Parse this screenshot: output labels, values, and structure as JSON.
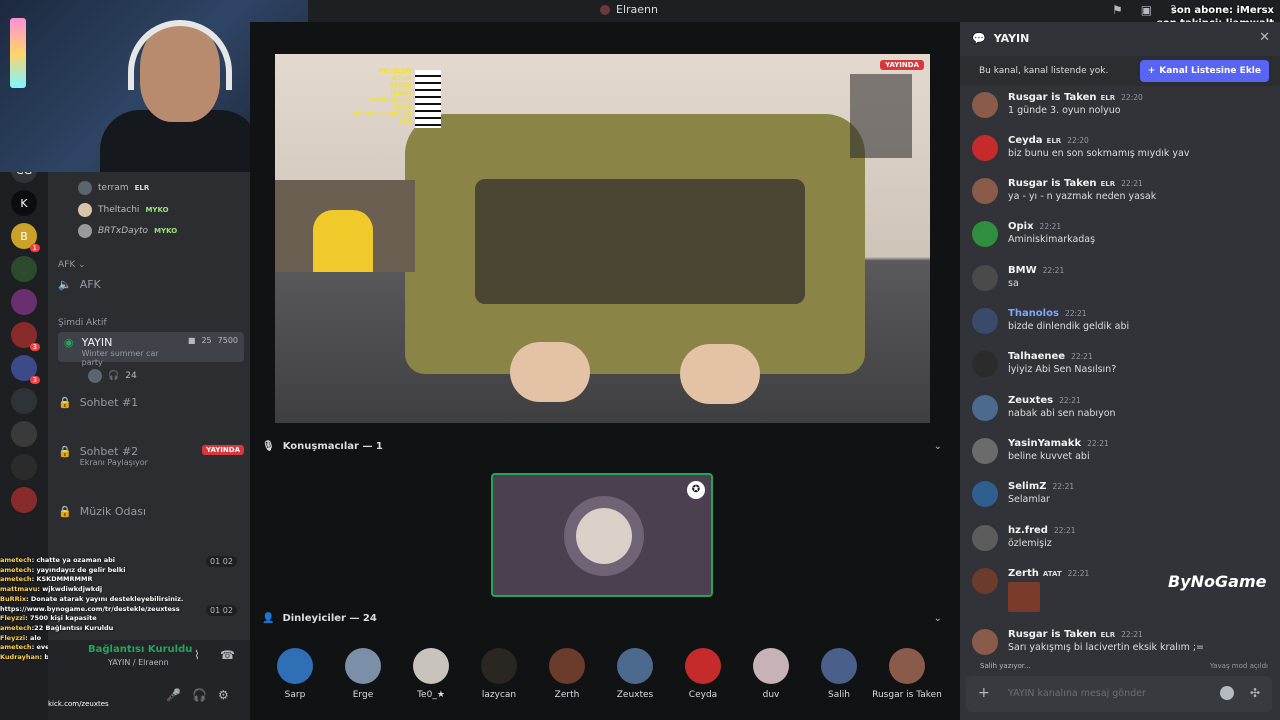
{
  "topbar": {
    "title": "Elraenn"
  },
  "overlay": {
    "line1": "son abone: iMersx",
    "line2": "son takipçi: liamwalt"
  },
  "rail": {
    "servers": [
      {
        "label": "CG",
        "color": "#313338",
        "badge": ""
      },
      {
        "label": "K",
        "color": "#0c0d10",
        "badge": ""
      },
      {
        "label": "B",
        "color": "#c9a227",
        "badge": "1"
      },
      {
        "label": "",
        "color": "#2c4a2c",
        "badge": ""
      },
      {
        "label": "",
        "color": "#6a2f6e",
        "badge": ""
      },
      {
        "label": "",
        "color": "#8a2b2b",
        "badge": "3"
      },
      {
        "label": "",
        "color": "#3c4a8a",
        "badge": "3"
      },
      {
        "label": "",
        "color": "#2e3338",
        "badge": ""
      },
      {
        "label": "",
        "color": "#3a3a3a",
        "badge": ""
      },
      {
        "label": "",
        "color": "#2b2b2b",
        "badge": ""
      },
      {
        "label": "",
        "color": "#8a2b2b",
        "badge": ""
      }
    ]
  },
  "sidebar": {
    "users": [
      {
        "name": "terram",
        "role": "ELR"
      },
      {
        "name": "Theltachi",
        "role": "MYKO"
      },
      {
        "name": "BRTxDayto",
        "role": "MYKO"
      }
    ],
    "afk_category": "AFK",
    "afk_channel": "AFK",
    "active_now": "Şimdi Aktif",
    "yayin": {
      "name": "YAYIN",
      "subtitle": "Winter summer car party",
      "count1": "25",
      "count2": "7500",
      "listeners": "24"
    },
    "sohbet1": "Sohbet #1",
    "sohbet2": {
      "name": "Sohbet #2",
      "subtitle": "Ekranı Paylaşıyor",
      "live": "YAYINDA"
    },
    "muzik": "Müzik Odası",
    "pill_a": "01 02",
    "pill_b": "01 02"
  },
  "twitch_chat": [
    {
      "n": "ametech",
      "t": ": chatte ya ozaman abi"
    },
    {
      "n": "ametech",
      "t": ": yayındayız de gelir belki"
    },
    {
      "n": "ametech",
      "t": ": KSKDMMRMMR"
    },
    {
      "n": "mattmavu",
      "t": ": wjkwdiwkdjwkdj"
    },
    {
      "n": "BuRRix",
      "t": ": Donate atarak yayını destekleyebilirsiniz."
    },
    {
      "n": "",
      "t": "https://www.bynogame.com/tr/destekle/zeuxtess"
    },
    {
      "n": "Fleyzzi",
      "t": ": 7500 kişi kapasite"
    },
    {
      "n": "ametech",
      "t": ":22 Bağlantısı Kuruldu"
    },
    {
      "n": "Fleyzzi",
      "t": ": alo"
    },
    {
      "n": "ametech",
      "t": ": evet"
    },
    {
      "n": "Kudrayhan",
      "t": ": bilmiyoki"
    }
  ],
  "voice": {
    "status": "Bağlantısı Kuruldu",
    "channel": "YAYIN / Elraenn",
    "footer": "kick.com/zeuxtes"
  },
  "stream": {
    "live": "YAYINDA",
    "hud": [
      "PROBLEM",
      "AÇLIK",
      "STRES",
      "İDRAR",
      "YORGUNLUK",
      "PARA",
      "VÜCUT SICAKLIĞI",
      "TER"
    ],
    "money": "721"
  },
  "speakers": {
    "title": "Konuşmacılar — 1"
  },
  "audience": {
    "title": "Dinleyiciler — 24",
    "items": [
      {
        "name": "Sarp",
        "color": "#2f6fb5"
      },
      {
        "name": "Erge",
        "color": "#7c8fa8"
      },
      {
        "name": "Te0_★",
        "color": "#c8c3bd"
      },
      {
        "name": "lazycan",
        "color": "#2a2622"
      },
      {
        "name": "Zerth",
        "color": "#6b3b2b"
      },
      {
        "name": "Zeuxtes",
        "color": "#4c6a8e"
      },
      {
        "name": "Ceyda",
        "color": "#c62b2b"
      },
      {
        "name": "duv",
        "color": "#c7b2b8"
      },
      {
        "name": "Salih",
        "color": "#4a5f8a"
      },
      {
        "name": "Rusgar is Taken",
        "color": "#8a5a4a"
      }
    ]
  },
  "chat": {
    "channel": "YAYIN",
    "notice": "Bu kanal, kanal listende yok.",
    "notice_button": "Kanal Listesine Ekle",
    "messages": [
      {
        "name": "Rusgar is Taken",
        "tag": "ELR",
        "time": "22:20",
        "text": "1 günde 3. oyun nolyuo",
        "color": "#8a5a4a",
        "namecolor": "#f2f3f5"
      },
      {
        "name": "Ceyda",
        "tag": "ELR",
        "time": "22:20",
        "text": "biz bunu en son sokmamış mıydık yav",
        "color": "#c62b2b",
        "namecolor": "#f2f3f5"
      },
      {
        "name": "Rusgar is Taken",
        "tag": "ELR",
        "time": "22:21",
        "text": "ya - yı - n yazmak neden yasak",
        "color": "#8a5a4a",
        "namecolor": "#f2f3f5"
      },
      {
        "name": "Opix",
        "tag": "",
        "time": "22:21",
        "text": "Aminiskimarkadaş",
        "color": "#2f8f3f",
        "namecolor": "#f2f3f5"
      },
      {
        "name": "BMW",
        "tag": "",
        "time": "22:21",
        "text": "sa",
        "color": "#4a4a4a",
        "namecolor": "#f2f3f5"
      },
      {
        "name": "Thanolos",
        "tag": "",
        "time": "22:21",
        "text": "bizde dinlendik geldik abi",
        "color": "#3a4a6a",
        "namecolor": "#7aa7ff"
      },
      {
        "name": "Talhaenee",
        "tag": "",
        "time": "22:21",
        "text": "İyiyiz Abi Sen Nasılsın?",
        "color": "#2b2b2b",
        "namecolor": "#f2f3f5"
      },
      {
        "name": "Zeuxtes",
        "tag": "",
        "time": "22:21",
        "text": "nabak abi sen nabıyon",
        "color": "#4c6a8e",
        "namecolor": "#f2f3f5"
      },
      {
        "name": "YasinYamakk",
        "tag": "",
        "time": "22:21",
        "text": "beline kuvvet abi",
        "color": "#6b6b6b",
        "namecolor": "#f2f3f5"
      },
      {
        "name": "SelimZ",
        "tag": "",
        "time": "22:21",
        "text": "Selamlar",
        "color": "#2f5f8f",
        "namecolor": "#f2f3f5"
      },
      {
        "name": "hz.fred",
        "tag": "",
        "time": "22:21",
        "text": "özlemişiz",
        "color": "#5c5c5c",
        "namecolor": "#f2f3f5"
      },
      {
        "name": "Zerth",
        "tag": "ATAT",
        "time": "22:21",
        "text": "",
        "color": "#6b3b2b",
        "namecolor": "#f2f3f5"
      },
      {
        "name": "Rusgar is Taken",
        "tag": "ELR",
        "time": "22:21",
        "text": "Sarı yakışmış bi lacivertin eksik kralım ;=",
        "color": "#8a5a4a",
        "namecolor": "#f2f3f5"
      }
    ],
    "typing": "Salih yazıyor...",
    "slowmode": "Yavaş mod açıldı",
    "input_placeholder": "YAYIN kanalına mesaj gönder"
  },
  "brand": "ByNoGame"
}
